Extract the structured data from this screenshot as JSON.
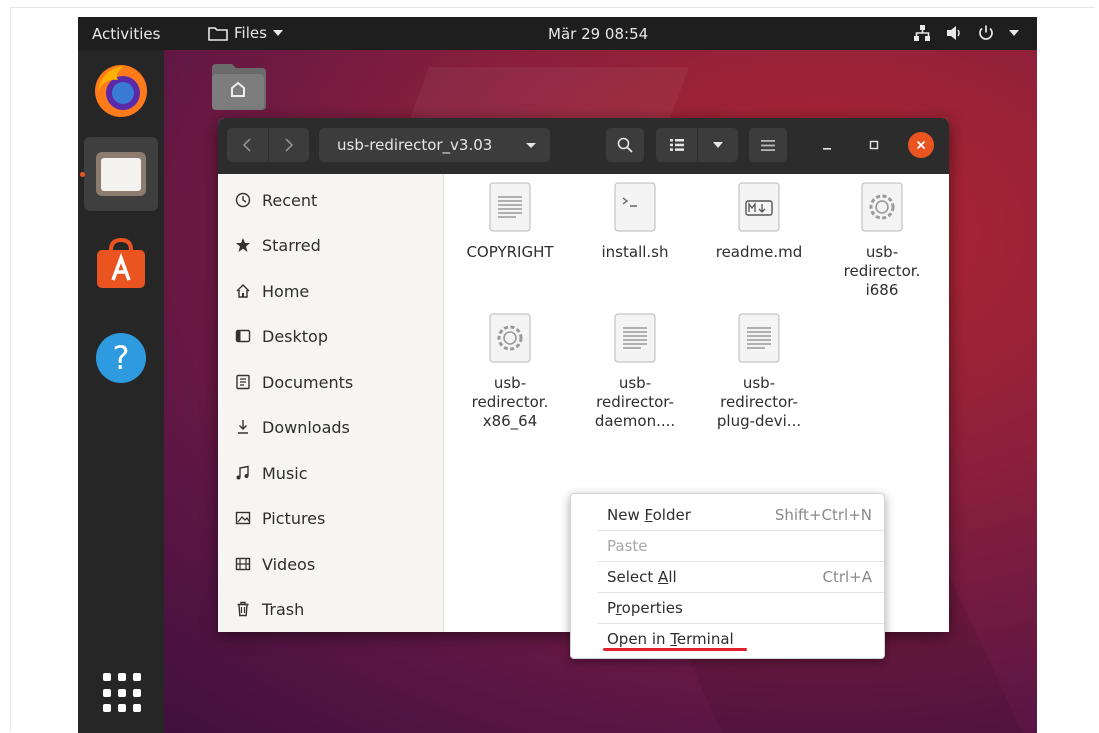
{
  "topbar": {
    "activities": "Activities",
    "app_menu": "Files",
    "clock": "Mär 29  08:54"
  },
  "window": {
    "path_label": "usb-redirector_v3.03"
  },
  "sidebar": {
    "items": [
      {
        "label": "Recent",
        "icon": "clock-icon"
      },
      {
        "label": "Starred",
        "icon": "star-icon"
      },
      {
        "label": "Home",
        "icon": "home-icon"
      },
      {
        "label": "Desktop",
        "icon": "desktop-icon"
      },
      {
        "label": "Documents",
        "icon": "documents-icon"
      },
      {
        "label": "Downloads",
        "icon": "download-icon"
      },
      {
        "label": "Music",
        "icon": "music-icon"
      },
      {
        "label": "Pictures",
        "icon": "pictures-icon"
      },
      {
        "label": "Videos",
        "icon": "videos-icon"
      },
      {
        "label": "Trash",
        "icon": "trash-icon"
      }
    ]
  },
  "files": [
    {
      "lines": [
        "COPYRIGHT"
      ],
      "icon": "text-file-icon"
    },
    {
      "lines": [
        "install.sh"
      ],
      "icon": "script-file-icon"
    },
    {
      "lines": [
        "readme.md"
      ],
      "icon": "markdown-file-icon"
    },
    {
      "lines": [
        "usb-",
        "redirector.",
        "i686"
      ],
      "icon": "executable-file-icon"
    },
    {
      "lines": [
        "usb-",
        "redirector.",
        "x86_64"
      ],
      "icon": "executable-file-icon"
    },
    {
      "lines": [
        "usb-",
        "redirector-",
        "daemon...."
      ],
      "icon": "text-file-icon"
    },
    {
      "lines": [
        "usb-",
        "redirector-",
        "plug-devi..."
      ],
      "icon": "text-file-icon"
    }
  ],
  "context_menu": {
    "new_folder": {
      "pre": "New ",
      "key": "F",
      "post": "older",
      "accel": "Shift+Ctrl+N"
    },
    "paste": {
      "label": "Paste"
    },
    "select_all": {
      "pre": "Select ",
      "key": "A",
      "post": "ll",
      "accel": "Ctrl+A"
    },
    "properties": {
      "pre": "P",
      "key": "r",
      "post": "operties"
    },
    "open_terminal": {
      "pre": "Open in ",
      "key": "T",
      "post": "erminal"
    }
  },
  "colors": {
    "accent": "#e95420",
    "highlight_underline": "#e0202c"
  }
}
